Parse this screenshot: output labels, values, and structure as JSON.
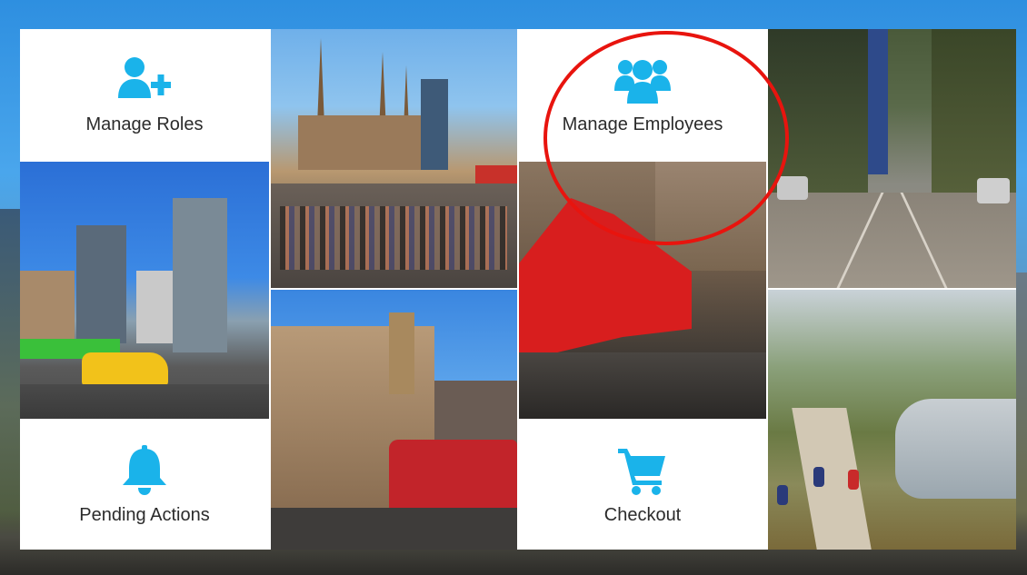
{
  "menu": {
    "manage_roles": {
      "label": "Manage Roles",
      "icon": "user-plus-icon"
    },
    "manage_employees": {
      "label": "Manage Employees",
      "icon": "users-group-icon"
    },
    "pending_actions": {
      "label": "Pending Actions",
      "icon": "bell-icon"
    },
    "checkout": {
      "label": "Checkout",
      "icon": "shopping-cart-icon"
    }
  },
  "photos": {
    "cathedral_square": "flinders-street-crowd-photo",
    "tram_street": "tram-tracks-avenue-photo",
    "city_skyline": "yarra-skyline-taxi-photo",
    "arts_sign": "arts-centre-red-sign-photo",
    "town_hall": "town-hall-tram-photo",
    "river_path": "river-cycling-path-photo"
  },
  "colors": {
    "icon_accent": "#1ab3ea",
    "label_text": "#2b2b2b",
    "highlight": "#e8140e",
    "arts_sign_red": "#d81e1e"
  }
}
